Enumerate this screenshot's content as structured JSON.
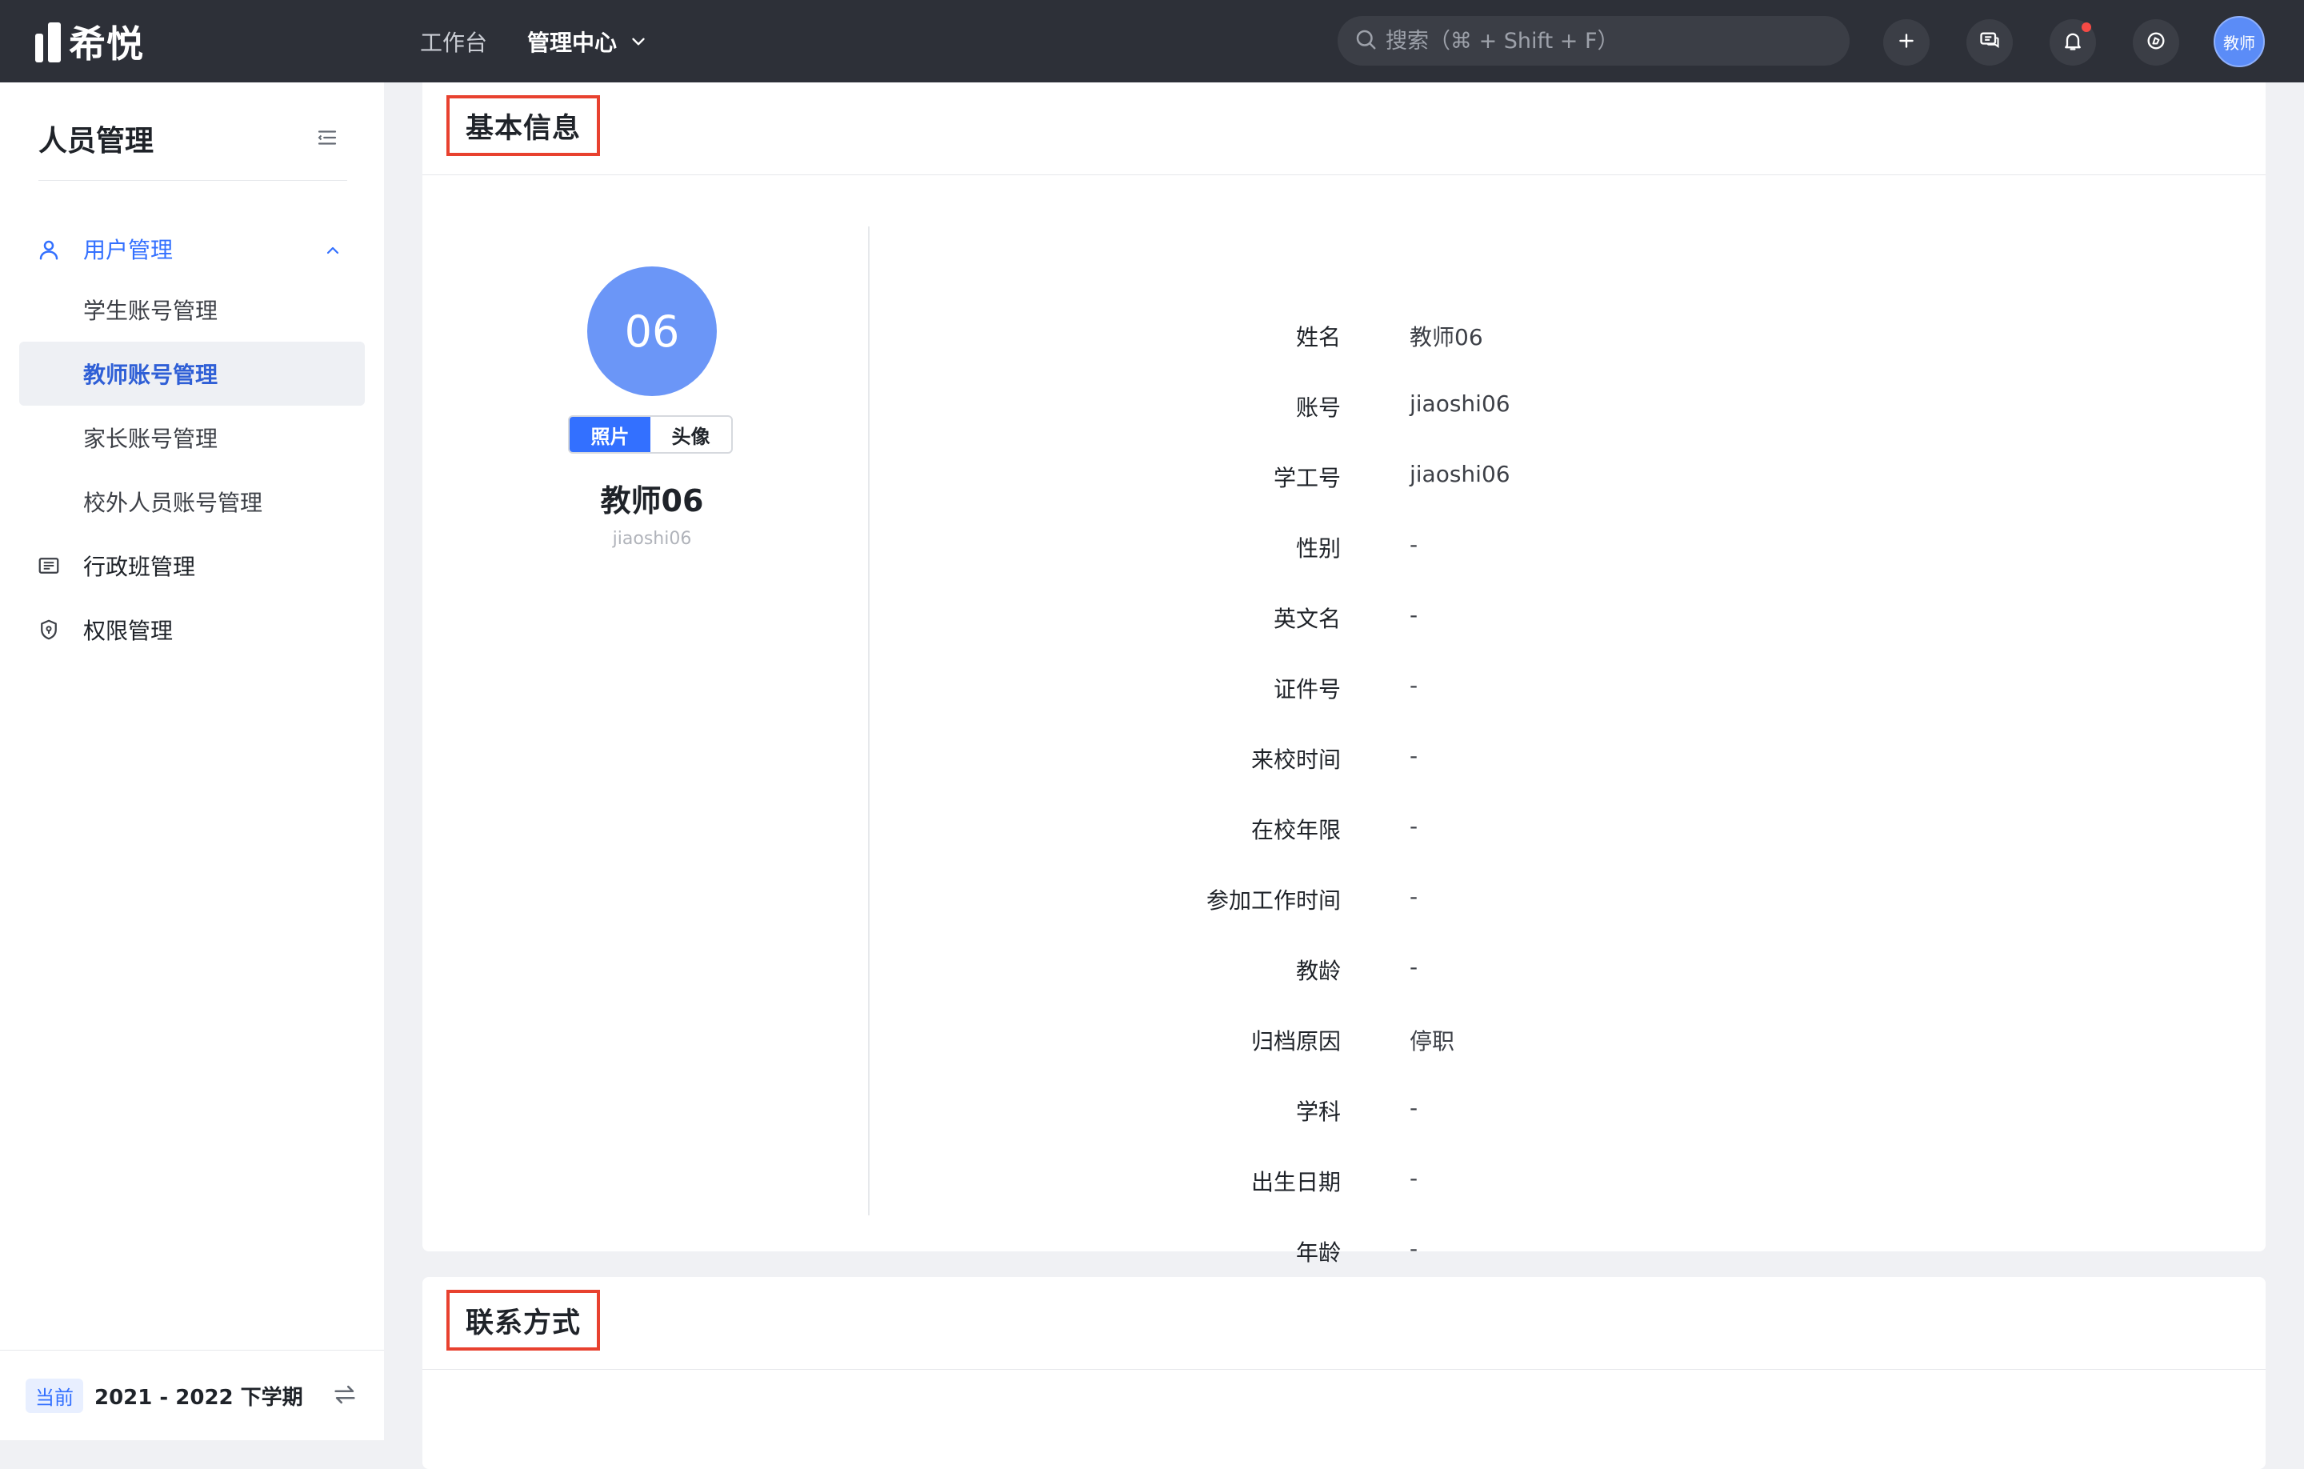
{
  "app": {
    "logo_text": "希悦"
  },
  "topnav": {
    "items": [
      {
        "label": "工作台"
      },
      {
        "label": "管理中心"
      }
    ]
  },
  "search": {
    "placeholder": "搜索（⌘ + Shift + F）"
  },
  "user": {
    "avatar_text": "教师"
  },
  "icons": {
    "search": "search-icon",
    "add": "plus-icon",
    "message": "chat-icon",
    "notification": "bell-icon",
    "app": "compass-icon",
    "collapse": "collapse-menu-icon",
    "user": "user-icon",
    "class": "list-card-icon",
    "permission": "shield-icon",
    "switch": "switch-arrows-icon"
  },
  "colors": {
    "accent": "#3370ff",
    "topbar": "#2d3038",
    "highlight_border": "#e8412f",
    "avatar": "#6b96f7"
  },
  "sidebar": {
    "title": "人员管理",
    "group": {
      "label": "用户管理",
      "children": [
        {
          "label": "学生账号管理"
        },
        {
          "label": "教师账号管理"
        },
        {
          "label": "家长账号管理"
        },
        {
          "label": "校外人员账号管理"
        }
      ]
    },
    "items": [
      {
        "label": "行政班管理"
      },
      {
        "label": "权限管理"
      }
    ],
    "footer": {
      "badge": "当前",
      "term": "2021 - 2022 下学期"
    }
  },
  "basic_info": {
    "title": "基本信息",
    "avatar_text": "06",
    "tabs": [
      {
        "label": "照片"
      },
      {
        "label": "头像"
      }
    ],
    "name": "教师06",
    "username": "jiaoshi06",
    "fields": [
      {
        "label": "姓名",
        "value": "教师06"
      },
      {
        "label": "账号",
        "value": "jiaoshi06"
      },
      {
        "label": "学工号",
        "value": "jiaoshi06"
      },
      {
        "label": "性别",
        "value": "-"
      },
      {
        "label": "英文名",
        "value": "-"
      },
      {
        "label": "证件号",
        "value": "-"
      },
      {
        "label": "来校时间",
        "value": "-"
      },
      {
        "label": "在校年限",
        "value": "-"
      },
      {
        "label": "参加工作时间",
        "value": "-"
      },
      {
        "label": "教龄",
        "value": "-"
      },
      {
        "label": "归档原因",
        "value": "停职"
      },
      {
        "label": "学科",
        "value": "-"
      },
      {
        "label": "出生日期",
        "value": "-"
      },
      {
        "label": "年龄",
        "value": "-"
      }
    ]
  },
  "contact": {
    "title": "联系方式"
  }
}
